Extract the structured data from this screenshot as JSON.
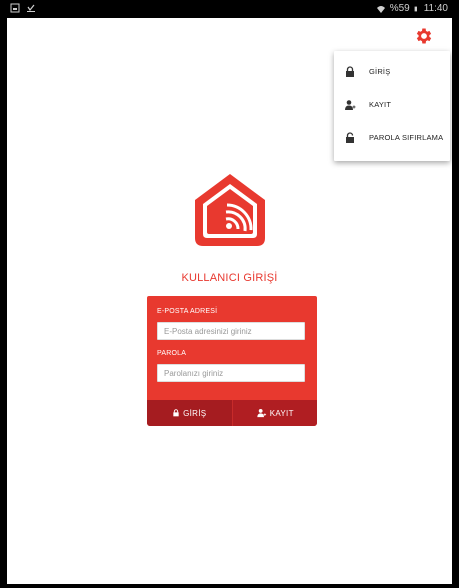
{
  "status_bar": {
    "battery_percent": "%59",
    "time": "11:40",
    "left_icons": [
      "screenshot-icon",
      "download-icon"
    ],
    "right_icons": [
      "wifi-icon",
      "battery-icon"
    ]
  },
  "settings_icon": "gear-icon",
  "menu": {
    "items": [
      {
        "label": "GİRİŞ",
        "icon": "lock-icon"
      },
      {
        "label": "KAYIT",
        "icon": "add-user-icon"
      },
      {
        "label": "PAROLA SIFIRLAMA",
        "icon": "unlock-icon"
      }
    ]
  },
  "login": {
    "title": "KULLANICI GİRİŞİ",
    "email_label": "E-POSTA ADRESİ",
    "email_placeholder": "E-Posta adresinizi giriniz",
    "email_value": "",
    "password_label": "PAROLA",
    "password_placeholder": "Parolanızı giriniz",
    "password_value": "",
    "login_button": "GİRİŞ",
    "register_button": "KAYIT"
  },
  "colors": {
    "accent": "#e8392f",
    "button_dark": "#a51c20"
  }
}
